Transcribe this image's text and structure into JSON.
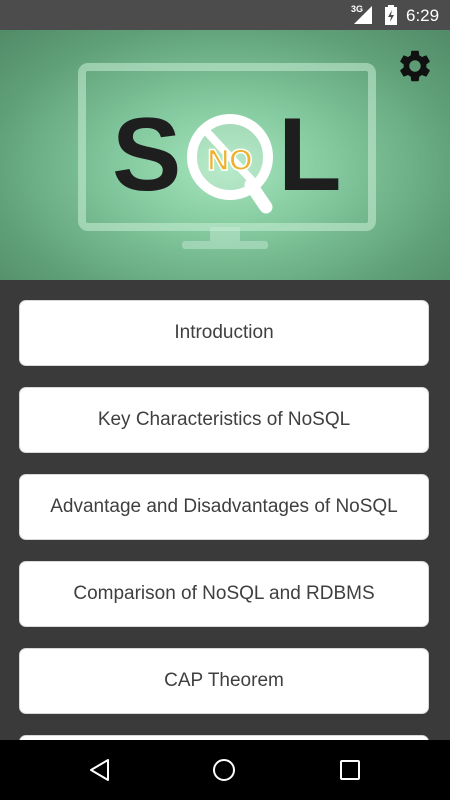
{
  "status_bar": {
    "network": "3G",
    "time": "6:29"
  },
  "banner": {
    "logo_left": "S",
    "logo_badge": "NO",
    "logo_right": "L"
  },
  "menu": {
    "items": [
      {
        "label": "Introduction"
      },
      {
        "label": "Key Characteristics of NoSQL"
      },
      {
        "label": "Advantage and Disadvantages of NoSQL"
      },
      {
        "label": "Comparison of NoSQL and RDBMS"
      },
      {
        "label": "CAP Theorem"
      },
      {
        "label": ""
      }
    ]
  },
  "nav_bar": {
    "icons": [
      "back-icon",
      "home-icon",
      "recents-icon"
    ]
  },
  "colors": {
    "banner_green": "#82c79d",
    "logo_yellow": "#f0b22e",
    "menu_bg": "#3a3a3a"
  }
}
